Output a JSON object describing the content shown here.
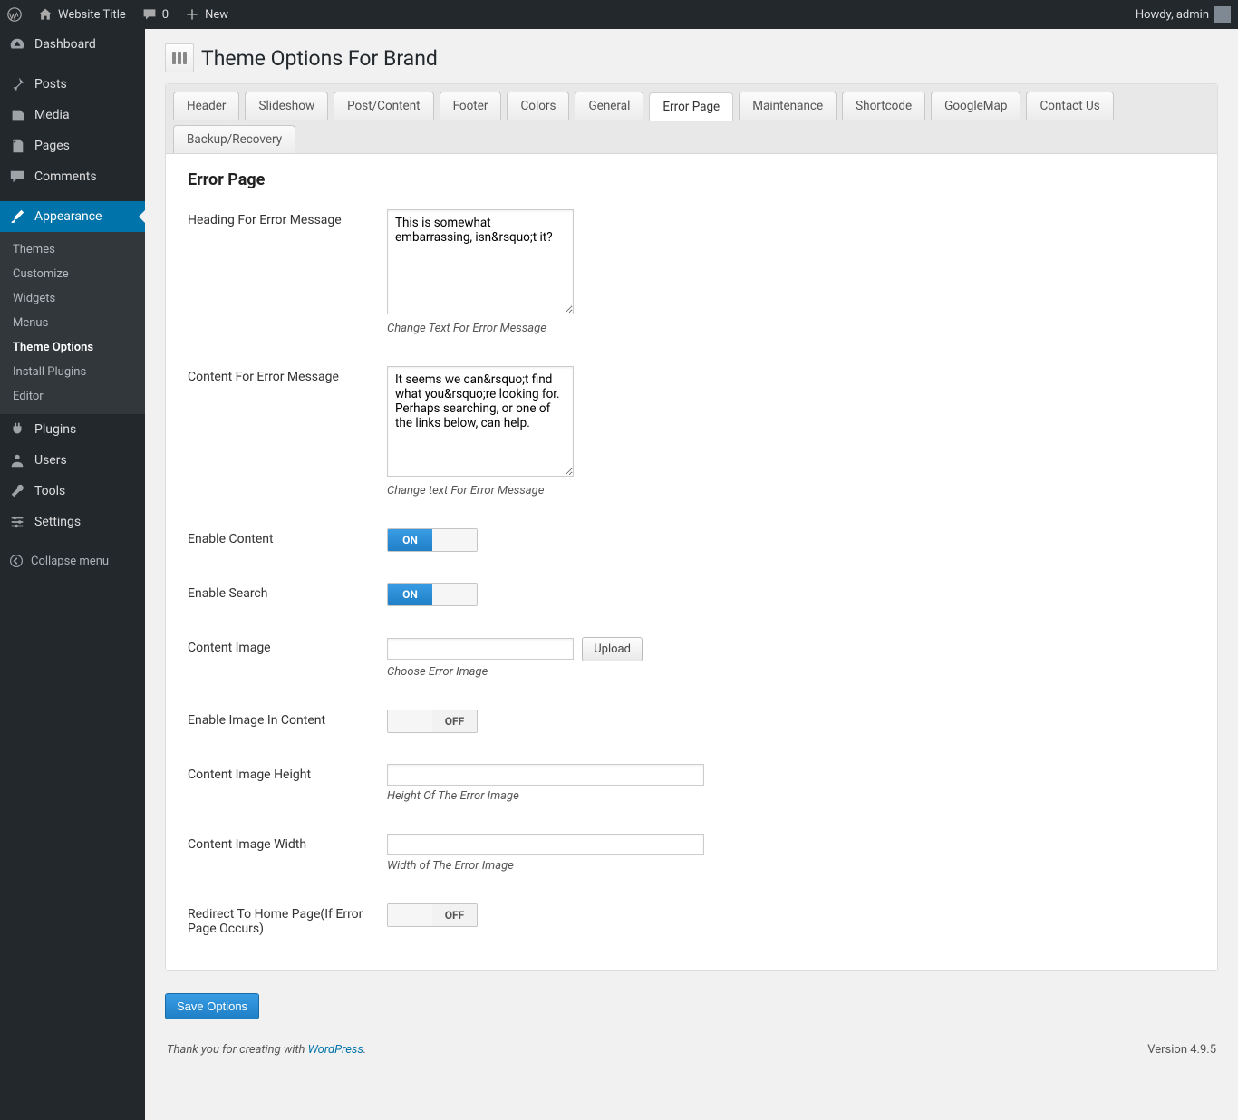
{
  "adminbar": {
    "site_title": "Website Title",
    "comments_count": "0",
    "new_label": "New",
    "howdy": "Howdy, admin"
  },
  "sidebar": {
    "items": [
      {
        "label": "Dashboard"
      },
      {
        "label": "Posts"
      },
      {
        "label": "Media"
      },
      {
        "label": "Pages"
      },
      {
        "label": "Comments"
      },
      {
        "label": "Appearance"
      },
      {
        "label": "Plugins"
      },
      {
        "label": "Users"
      },
      {
        "label": "Tools"
      },
      {
        "label": "Settings"
      }
    ],
    "submenu": [
      {
        "label": "Themes"
      },
      {
        "label": "Customize"
      },
      {
        "label": "Widgets"
      },
      {
        "label": "Menus"
      },
      {
        "label": "Theme Options"
      },
      {
        "label": "Install Plugins"
      },
      {
        "label": "Editor"
      }
    ],
    "collapse": "Collapse menu"
  },
  "page": {
    "title": "Theme Options For Brand",
    "tabs": [
      "Header",
      "Slideshow",
      "Post/Content",
      "Footer",
      "Colors",
      "General",
      "Error Page",
      "Maintenance",
      "Shortcode",
      "GoogleMap",
      "Contact Us",
      "Backup/Recovery"
    ],
    "section_title": "Error Page",
    "fields": {
      "heading_label": "Heading For Error Message",
      "heading_value": "This is somewhat embarrassing, isn&rsquo;t it?",
      "heading_help": "Change Text For Error Message",
      "content_label": "Content For Error Message",
      "content_value": "It seems we can&rsquo;t find what you&rsquo;re looking for. Perhaps searching, or one of the links below, can help.",
      "content_help": "Change text For Error Message",
      "enable_content_label": "Enable Content",
      "enable_search_label": "Enable Search",
      "content_image_label": "Content Image",
      "content_image_value": "",
      "upload_label": "Upload",
      "content_image_help": "Choose Error Image",
      "enable_image_label": "Enable Image In Content",
      "height_label": "Content Image Height",
      "height_value": "",
      "height_help": "Height Of The Error Image",
      "width_label": "Content Image Width",
      "width_value": "",
      "width_help": "Width of The Error Image",
      "redirect_label": "Redirect To Home Page(If Error Page Occurs)"
    },
    "on_text": "ON",
    "off_text": "OFF",
    "save_label": "Save Options"
  },
  "footer": {
    "thanks_prefix": "Thank you for creating with ",
    "wp_link": "WordPress",
    "period": ".",
    "version": "Version 4.9.5"
  }
}
